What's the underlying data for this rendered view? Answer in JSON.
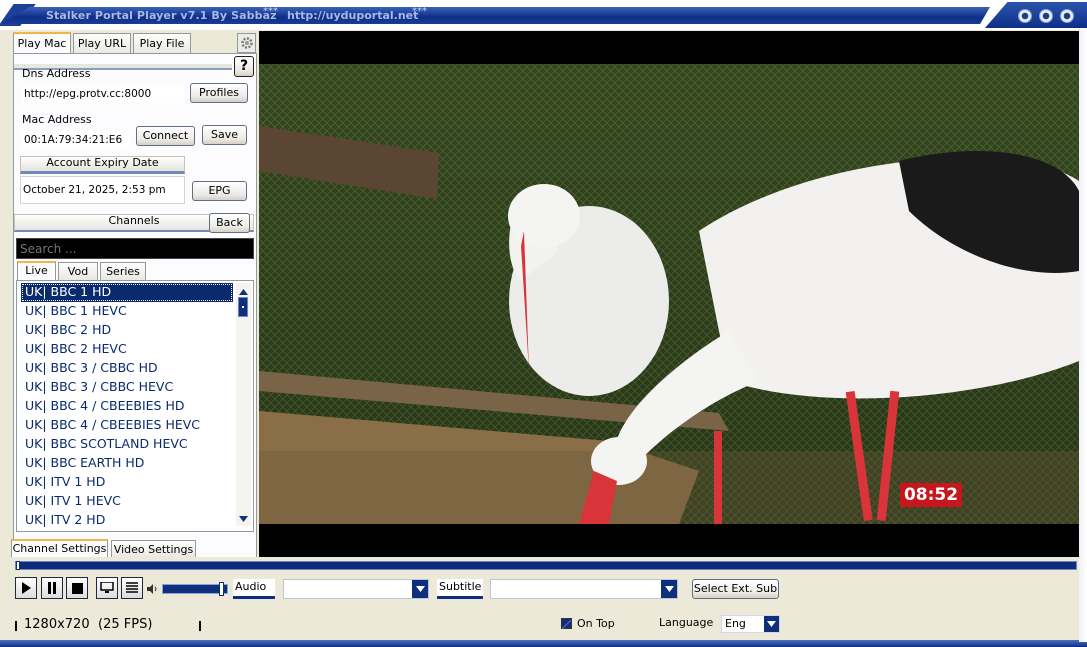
{
  "title": {
    "app_name": "Stalker Portal Player v7.1 By Sabbaz",
    "stars": "***",
    "url": "http://uyduportal.net"
  },
  "tabs": [
    "Play Mac",
    "Play URL",
    "Play File"
  ],
  "dns": {
    "label": "Dns Address",
    "value": "http://epg.protv.cc:8000",
    "profiles_button": "Profiles"
  },
  "mac": {
    "label": "Mac Address",
    "value": "00:1A:79:34:21:E6",
    "connect_button": "Connect",
    "save_button": "Save"
  },
  "expiry": {
    "label": "Account Expiry Date",
    "value": "October 21, 2025, 2:53 pm",
    "epg_button": "EPG"
  },
  "channels": {
    "header": "Channels",
    "back_button": "Back",
    "search_placeholder": "Search ...",
    "tabs": [
      "Live",
      "Vod",
      "Series"
    ],
    "items": [
      "UK| BBC 1 HD",
      "UK| BBC 1 HEVC",
      "UK| BBC 2 HD",
      "UK| BBC 2 HEVC",
      "UK| BBC 3 / CBBC HD",
      "UK| BBC 3 / CBBC HEVC",
      "UK| BBC 4 / CBEEBIES HD",
      "UK| BBC 4 / CBEEBIES HEVC",
      "UK| BBC SCOTLAND HEVC",
      "UK| BBC EARTH HD",
      "UK| ITV 1 HD",
      "UK| ITV 1 HEVC",
      "UK| ITV 2 HD"
    ],
    "selected_index": 0
  },
  "settings_tabs": [
    "Channel Settings",
    "Video Settings"
  ],
  "help_glyph": "?",
  "video": {
    "clock": "08:52"
  },
  "controls": {
    "audio_label": "Audio",
    "subtitle_label": "Subtitle",
    "select_ext_sub": "Select Ext. Sub",
    "resolution": "1280x720",
    "fps": "(25 FPS)",
    "on_top_label": "On Top",
    "on_top_checked": true,
    "language_label": "Language",
    "language_value": "Eng",
    "volume_level": 1.0
  },
  "colors": {
    "accent": "#0f2f7d",
    "list_text": "#0b2a6e",
    "clock_bg": "#c8161d"
  }
}
